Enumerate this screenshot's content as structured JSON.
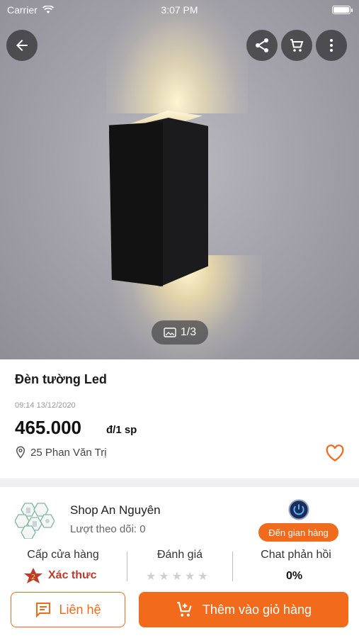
{
  "status_bar": {
    "carrier": "Carrier",
    "time": "3:07 PM"
  },
  "gallery": {
    "counter": "1/3"
  },
  "product": {
    "title": "Đèn tường Led",
    "posted_at": "09:14 13/12/2020",
    "price": "465.000",
    "price_unit": "đ/1 sp",
    "location": "25 Phan Văn Trị"
  },
  "shop": {
    "name": "Shop An Nguyên",
    "followers": "Lượt theo dõi: 0",
    "visit_label": "Đến gian hàng"
  },
  "stats": {
    "tier_label": "Cấp cửa hàng",
    "tier_value": "Xác thưc",
    "tier_badge": "2",
    "rating_label": "Đánh giá",
    "rating_value": 0,
    "response_label": "Chat phản hồi",
    "response_value": "0%"
  },
  "actions": {
    "contact_label": "Liên hệ",
    "add_cart_label": "Thêm vào giỏ hàng"
  },
  "colors": {
    "accent": "#f26a1b",
    "tier_red": "#c0392b"
  }
}
